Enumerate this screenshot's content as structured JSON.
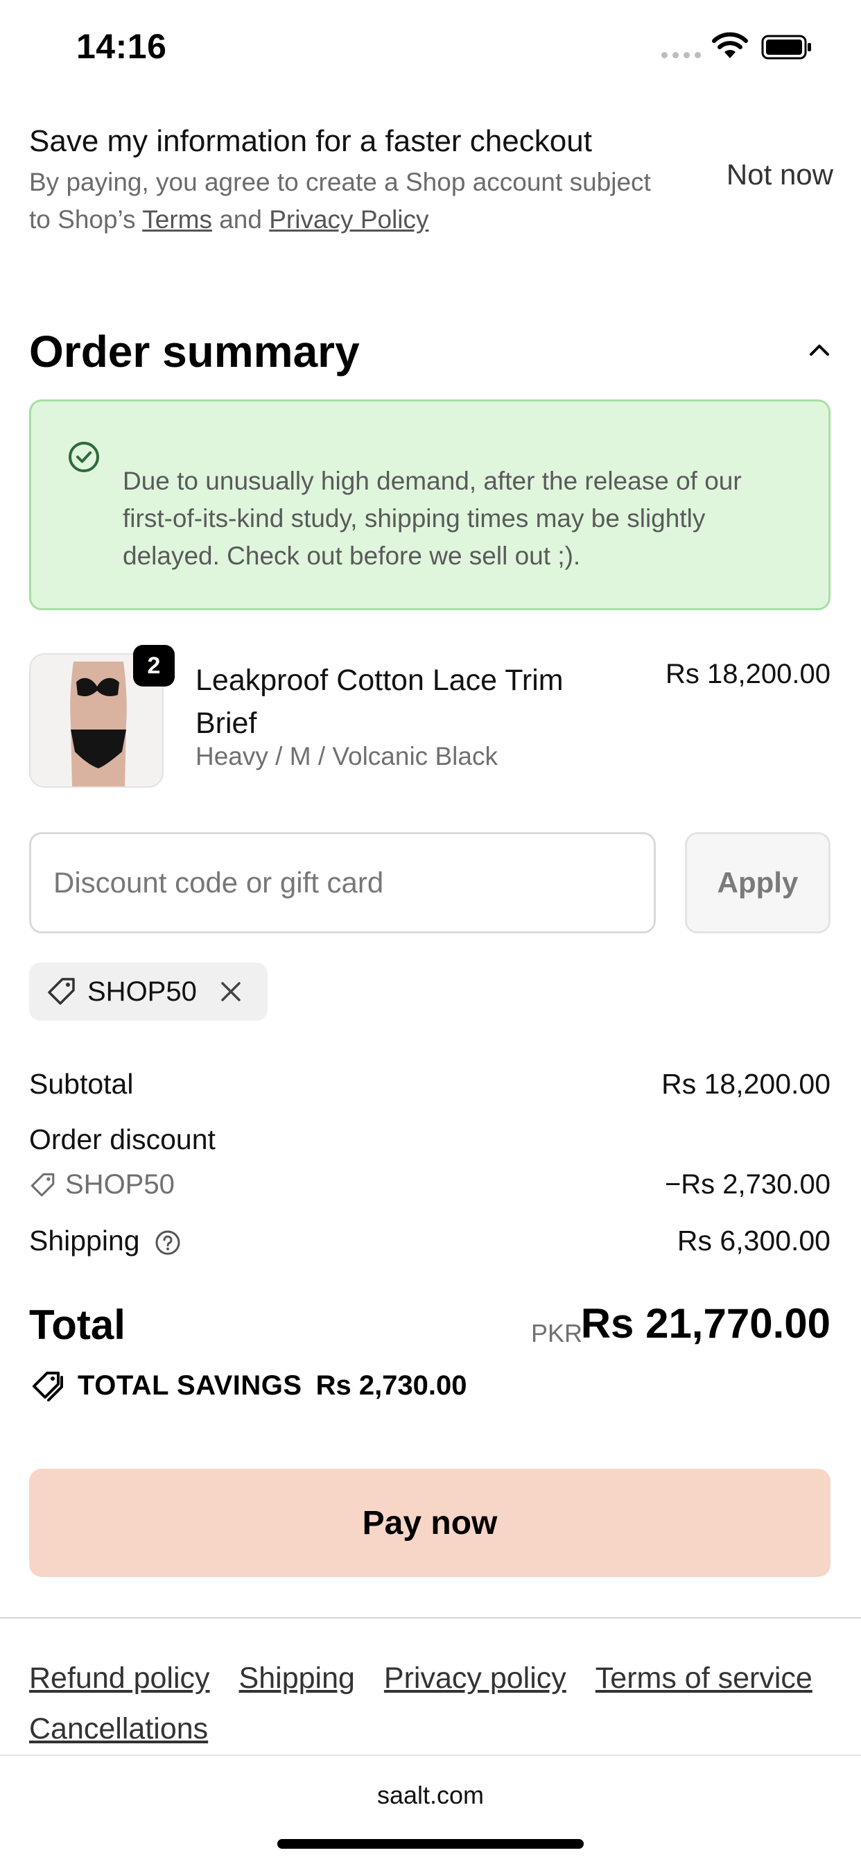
{
  "status_bar": {
    "time": "14:16"
  },
  "save_info": {
    "title": "Save my information for a faster checkout",
    "sub_prefix": "By paying, you agree to create a Shop account subject to Shop’s ",
    "terms": "Terms",
    "and": " and ",
    "privacy": "Privacy Policy",
    "not_now": "Not now"
  },
  "order_summary": {
    "title": "Order summary",
    "banner_text": "Due to unusually high demand, after the release of our first-of-its-kind study, shipping times may be slightly delayed. Check out before we sell out ;).",
    "product": {
      "quantity": "2",
      "name": "Leakproof Cotton Lace Trim Brief",
      "variant": "Heavy / M / Volcanic Black",
      "price": "Rs 18,200.00"
    },
    "discount": {
      "placeholder": "Discount code or gift card",
      "apply_label": "Apply",
      "applied_code": "SHOP50"
    },
    "lines": {
      "subtotal_label": "Subtotal",
      "subtotal_value": "Rs 18,200.00",
      "order_discount_label": "Order discount",
      "discount_code": "SHOP50",
      "discount_value": "−Rs 2,730.00",
      "shipping_label": "Shipping",
      "shipping_value": "Rs 6,300.00"
    },
    "total": {
      "label": "Total",
      "currency": "PKR",
      "value": "Rs 21,770.00",
      "savings_label": "TOTAL SAVINGS",
      "savings_value": "Rs 2,730.00"
    },
    "pay_label": "Pay now"
  },
  "footer": {
    "links": [
      "Refund policy",
      "Shipping",
      "Privacy policy",
      "Terms of service",
      "Cancellations"
    ]
  },
  "browser": {
    "url": "saalt.com"
  },
  "colors": {
    "banner_bg": "#dff6dd",
    "banner_border": "#a7dfa3",
    "pay_button": "#f7d6c7"
  }
}
